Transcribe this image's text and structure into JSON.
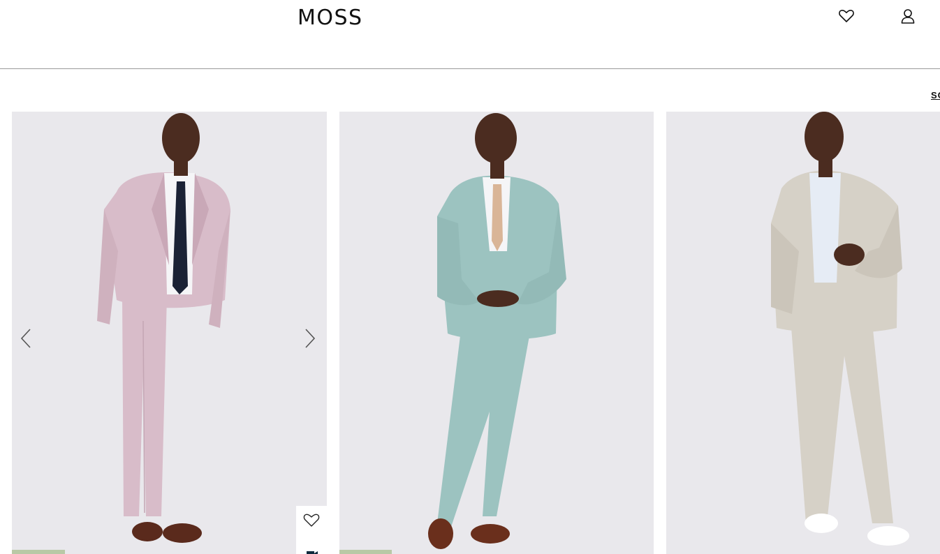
{
  "header": {
    "logo_text": "MOSS",
    "icons": [
      "heart-icon",
      "user-icon"
    ]
  },
  "toolbar": {
    "sort_label": "SO"
  },
  "products": [
    {
      "name": "pink-suit",
      "suit_color": "#d8bcc9",
      "tie_color": "#1b2235",
      "image_nav": [
        "chevron-left-icon",
        "chevron-right-icon"
      ],
      "wishlist_icon": "heart-icon",
      "video_icon": "video-camera-icon"
    },
    {
      "name": "sage-green-suit",
      "suit_color": "#9cc3c0",
      "tie_color": "#d9b597"
    },
    {
      "name": "stone-linen-suit",
      "suit_color": "#d6d1c7",
      "tie_color": ""
    }
  ],
  "colors": {
    "badge": "#b9c9a6",
    "photo_bg": "#e9e8ec",
    "divider": "#9a9a9a"
  }
}
